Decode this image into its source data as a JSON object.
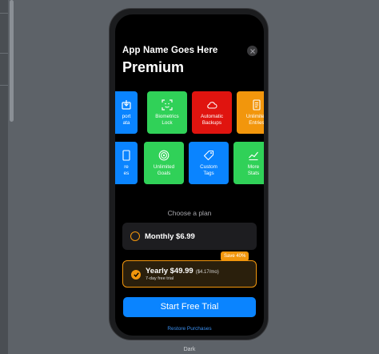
{
  "canvas": {
    "label": "Dark"
  },
  "paywall": {
    "app_name": "App Name Goes Here",
    "title": "Premium",
    "features_row1": [
      {
        "label": "Export\nData",
        "visible_label": "port\nata",
        "color": "#0a84ff",
        "icon": "export-icon"
      },
      {
        "label": "Biometrics\nLock",
        "color": "#30d158",
        "icon": "face-id-icon"
      },
      {
        "label": "Automatic\nBackups",
        "color": "#e0140f",
        "icon": "cloud-icon"
      },
      {
        "label": "Unlimited\nEntries",
        "color": "#f2960c",
        "icon": "document-icon"
      }
    ],
    "features_row2": [
      {
        "visible_label": "re\nes",
        "color": "#0a84ff",
        "icon": "document-icon"
      },
      {
        "label": "Unlimited\nGoals",
        "color": "#30d158",
        "icon": "target-icon"
      },
      {
        "label": "Custom\nTags",
        "color": "#0a84ff",
        "icon": "tag-icon"
      },
      {
        "label": "More\nStats",
        "color": "#30d158",
        "icon": "chart-icon"
      }
    ],
    "choose_plan": "Choose a plan",
    "plans": [
      {
        "label": "Monthly $6.99",
        "selected": false
      },
      {
        "label": "Yearly $49.99",
        "per_month": "($4.17/mo)",
        "trial": "7-day free trial",
        "badge": "Save 40%",
        "selected": true
      }
    ],
    "cta_label": "Start Free Trial",
    "restore_label": "Restore Purchases",
    "accent_color": "#f2960c",
    "cta_color": "#0a84ff"
  }
}
